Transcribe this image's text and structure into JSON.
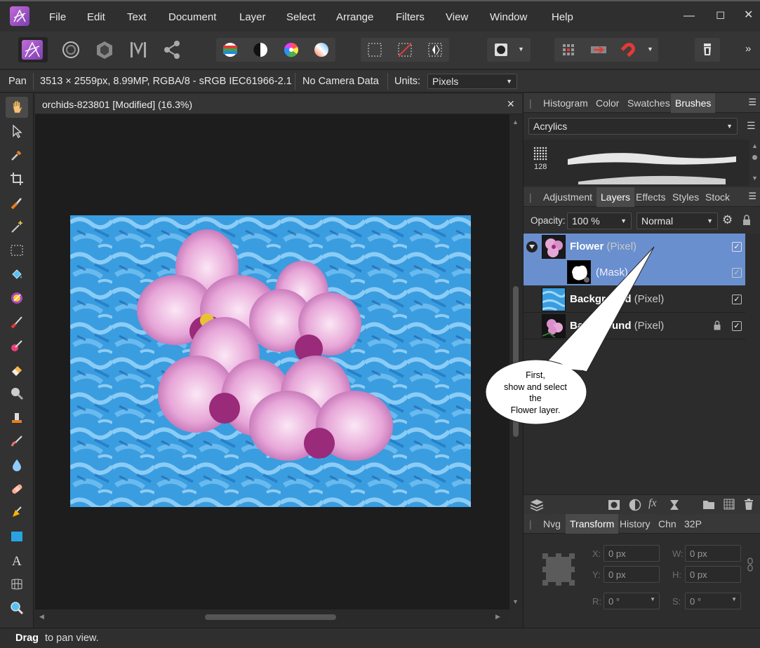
{
  "menu": [
    "File",
    "Edit",
    "Text",
    "Document",
    "Layer",
    "Select",
    "Arrange",
    "Filters",
    "View",
    "Window",
    "Help"
  ],
  "toolbar": {
    "personas": [
      "photo-persona-icon",
      "liquify-persona-icon",
      "develop-persona-icon",
      "tone-mapping-persona-icon",
      "export-persona-icon"
    ],
    "more": "»"
  },
  "context": {
    "tool": "Pan",
    "doc_info": "3513 × 2559px, 8.99MP, RGBA/8 - sRGB IEC61966-2.1",
    "camera": "No Camera Data",
    "units_label": "Units:",
    "units_value": "Pixels"
  },
  "document": {
    "title": "orchids-823801 [Modified] (16.3%)",
    "close": "✕"
  },
  "brushes_panel": {
    "tabs": [
      "Histogram",
      "Color",
      "Swatches",
      "Brushes"
    ],
    "active_tab": "Brushes",
    "category": "Acrylics",
    "brush_size": "128"
  },
  "layers_panel": {
    "tabs": [
      "Adjustment",
      "Layers",
      "Effects",
      "Styles",
      "Stock"
    ],
    "active_tab": "Layers",
    "opacity_label": "Opacity:",
    "opacity_value": "100 %",
    "blend_mode": "Normal",
    "layers": [
      {
        "name": "Flower",
        "type": "(Pixel)",
        "selected": true,
        "visible": true,
        "locked": false
      },
      {
        "name": "",
        "type": "(Mask)",
        "selected": true,
        "visible": true,
        "locked": false
      },
      {
        "name": "Background",
        "type": "(Pixel)",
        "selected": false,
        "visible": true,
        "locked": false
      },
      {
        "name": "Background",
        "type": "(Pixel)",
        "selected": false,
        "visible": true,
        "locked": true
      }
    ]
  },
  "callout": {
    "lines": [
      "First,",
      "show and select",
      "the",
      "Flower layer."
    ]
  },
  "transform_panel": {
    "tabs": [
      "Nvg",
      "Transform",
      "History",
      "Chn",
      "32P"
    ],
    "active_tab": "Transform",
    "x_label": "X:",
    "x_value": "0 px",
    "y_label": "Y:",
    "y_value": "0 px",
    "w_label": "W:",
    "w_value": "0 px",
    "h_label": "H:",
    "h_value": "0 px",
    "r_label": "R:",
    "r_value": "0 °",
    "s_label": "S:",
    "s_value": "0 °"
  },
  "status": {
    "bold": "Drag",
    "rest": " to pan view."
  },
  "colors": {
    "selection": "#6a8fce",
    "accent": "#8e3fbe"
  }
}
